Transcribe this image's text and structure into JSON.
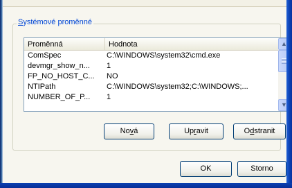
{
  "group": {
    "label_accel": "S",
    "label_rest": "ystémové proměnné"
  },
  "list": {
    "columns": [
      "Proměnná",
      "Hodnota"
    ],
    "rows": [
      {
        "name": "ComSpec",
        "value": "C:\\WINDOWS\\system32\\cmd.exe"
      },
      {
        "name": "devmgr_show_n...",
        "value": "1"
      },
      {
        "name": "FP_NO_HOST_C...",
        "value": "NO"
      },
      {
        "name": "NTIPath",
        "value": "C:\\WINDOWS\\system32;C:\\WINDOWS;..."
      },
      {
        "name": "NUMBER_OF_P...",
        "value": "1"
      }
    ]
  },
  "buttons": {
    "nova_pre": "No",
    "nova_accel": "v",
    "nova_post": "á",
    "upravit_pre": "Up",
    "upravit_accel": "r",
    "upravit_post": "avit",
    "odstranit_pre": "O",
    "odstranit_accel": "d",
    "odstranit_post": "stranit",
    "ok": "OK",
    "storno": "Storno"
  },
  "icons": {
    "scroll_up": "chevron-up-icon",
    "scroll_down": "chevron-down-icon"
  },
  "colors": {
    "legend": "#0046d5",
    "window_frame": "#0b3fb0",
    "dialog_bg": "#ece9d8"
  }
}
